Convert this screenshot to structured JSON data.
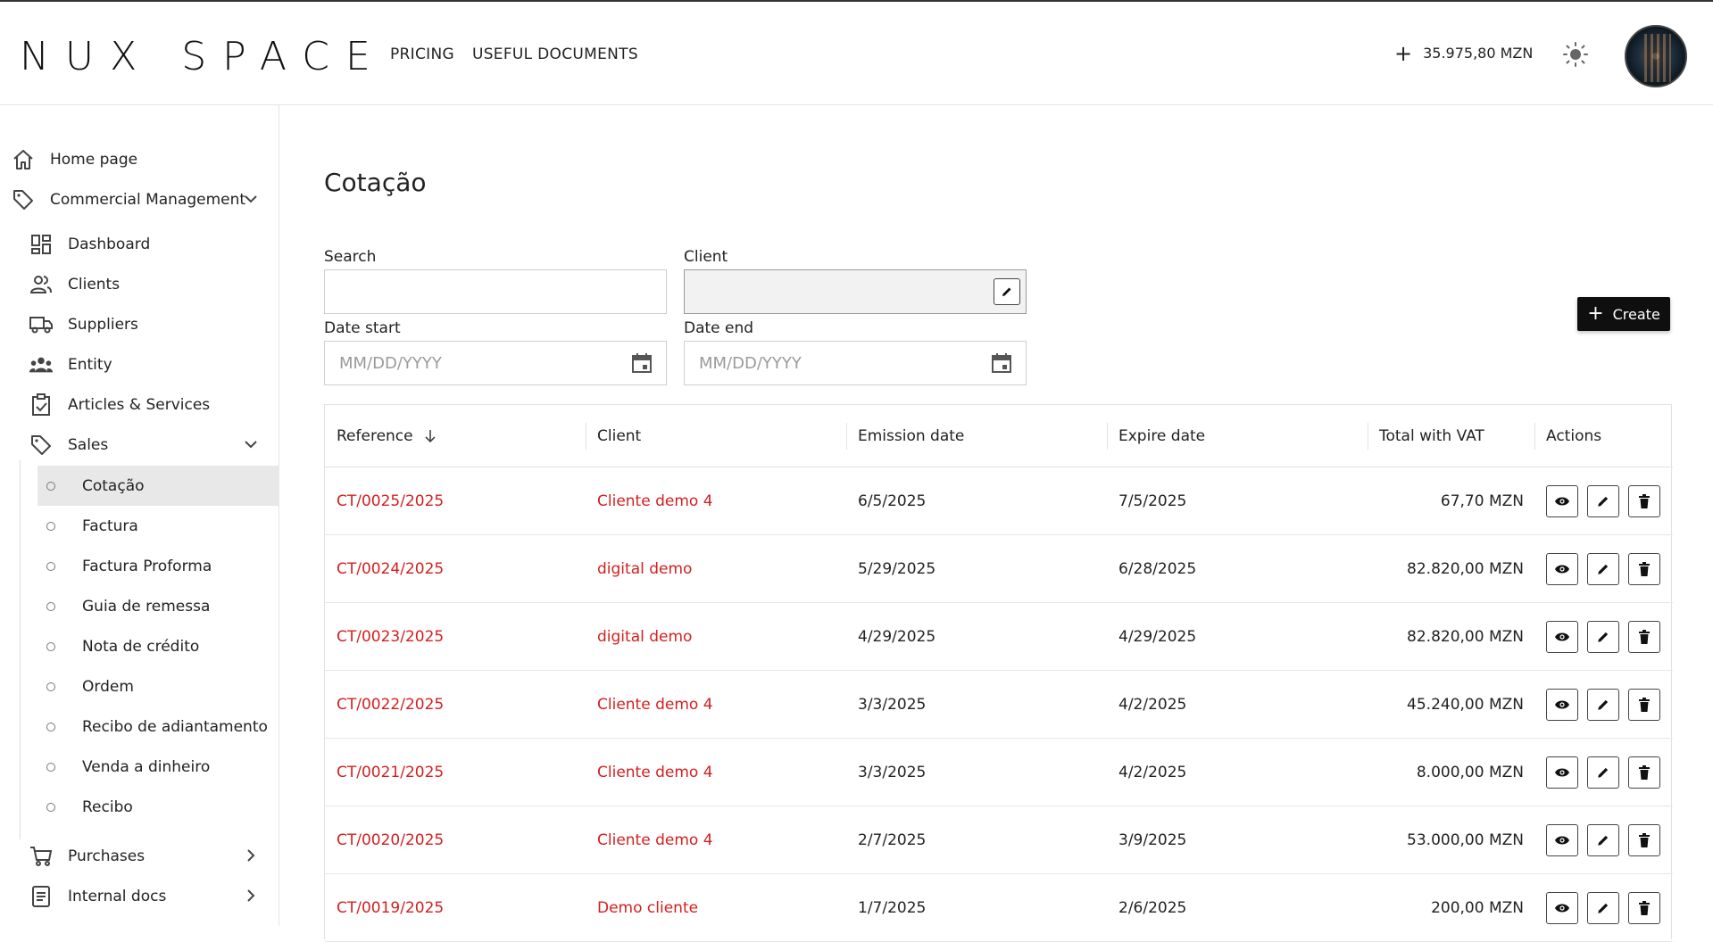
{
  "brand": {
    "logo_text": "NUX SPACE"
  },
  "topnav": {
    "pricing": "PRICING",
    "documents": "USEFUL DOCUMENTS"
  },
  "header": {
    "balance": "35.975,80 MZN",
    "add_icon": "plus-icon",
    "theme_icon": "sun-icon"
  },
  "sidebar": {
    "home": "Home page",
    "commercial": "Commercial Management",
    "dashboard": "Dashboard",
    "clients": "Clients",
    "suppliers": "Suppliers",
    "entity": "Entity",
    "articles": "Articles & Services",
    "sales": "Sales",
    "sales_items": [
      "Cotação",
      "Factura",
      "Factura Proforma",
      "Guia de remessa",
      "Nota de crédito",
      "Ordem",
      "Recibo de adiantamento",
      "Venda a dinheiro",
      "Recibo"
    ],
    "active_sales_item": "Cotação",
    "purchases": "Purchases",
    "internal_docs": "Internal docs"
  },
  "main": {
    "title": "Cotação",
    "filters": {
      "search_label": "Search",
      "client_label": "Client",
      "date_start_label": "Date start",
      "date_end_label": "Date end",
      "date_placeholder": "MM/DD/YYYY"
    },
    "create_label": "Create",
    "table": {
      "columns": [
        "Reference",
        "Client",
        "Emission date",
        "Expire date",
        "Total with VAT",
        "Actions"
      ],
      "sort_column": "Reference",
      "sort_direction": "descending",
      "rows": [
        {
          "reference": "CT/0025/2025",
          "client": "Cliente demo 4",
          "emission": "6/5/2025",
          "expire": "7/5/2025",
          "total": "67,70 MZN"
        },
        {
          "reference": "CT/0024/2025",
          "client": "digital demo",
          "emission": "5/29/2025",
          "expire": "6/28/2025",
          "total": "82.820,00 MZN"
        },
        {
          "reference": "CT/0023/2025",
          "client": "digital demo",
          "emission": "4/29/2025",
          "expire": "4/29/2025",
          "total": "82.820,00 MZN"
        },
        {
          "reference": "CT/0022/2025",
          "client": "Cliente demo 4",
          "emission": "3/3/2025",
          "expire": "4/2/2025",
          "total": "45.240,00 MZN"
        },
        {
          "reference": "CT/0021/2025",
          "client": "Cliente demo 4",
          "emission": "3/3/2025",
          "expire": "4/2/2025",
          "total": "8.000,00 MZN"
        },
        {
          "reference": "CT/0020/2025",
          "client": "Cliente demo 4",
          "emission": "2/7/2025",
          "expire": "3/9/2025",
          "total": "53.000,00 MZN"
        },
        {
          "reference": "CT/0019/2025",
          "client": "Demo cliente",
          "emission": "1/7/2025",
          "expire": "2/6/2025",
          "total": "200,00 MZN"
        }
      ]
    }
  },
  "colors": {
    "link_red": "#d32020",
    "create_bg": "#0f0f0f",
    "active_bg": "#e8e8e8"
  }
}
